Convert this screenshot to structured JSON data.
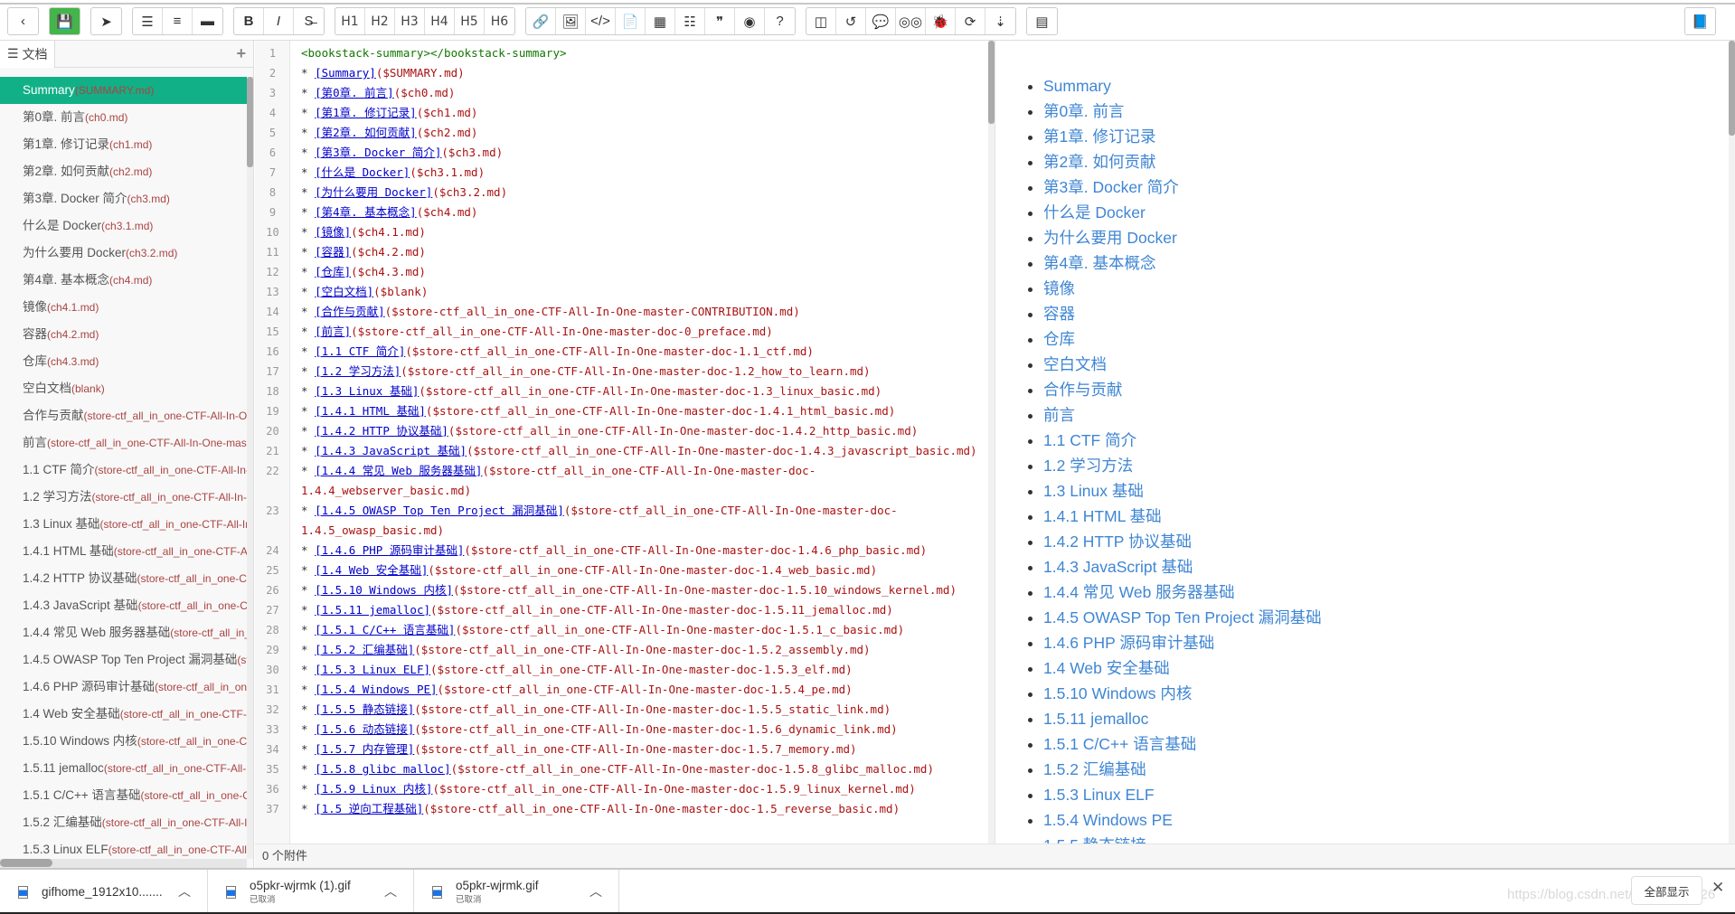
{
  "toolbar": {
    "groups": [
      [
        {
          "name": "back-button",
          "icon": "‹"
        }
      ],
      [
        {
          "name": "save-button",
          "icon": "💾",
          "save": true
        }
      ],
      [
        {
          "name": "publish-button",
          "icon": "➤"
        }
      ],
      [
        {
          "name": "unordered-list-button",
          "icon": "☰"
        },
        {
          "name": "ordered-list-button",
          "icon": "≡"
        },
        {
          "name": "horizontal-rule-button",
          "icon": "▬"
        }
      ],
      [
        {
          "name": "bold-button",
          "icon": "B"
        },
        {
          "name": "italic-button",
          "icon": "I"
        },
        {
          "name": "strikethrough-button",
          "icon": "S̶"
        }
      ],
      [
        {
          "name": "h1-button",
          "label": "H1"
        },
        {
          "name": "h2-button",
          "label": "H2"
        },
        {
          "name": "h3-button",
          "label": "H3"
        },
        {
          "name": "h4-button",
          "label": "H4"
        },
        {
          "name": "h5-button",
          "label": "H5"
        },
        {
          "name": "h6-button",
          "label": "H6"
        }
      ],
      [
        {
          "name": "link-button",
          "icon": "🔗"
        },
        {
          "name": "image-button",
          "icon": "🖼"
        },
        {
          "name": "code-button",
          "icon": "</>"
        },
        {
          "name": "code-block-button",
          "icon": "📄"
        },
        {
          "name": "table-button",
          "icon": "▦"
        },
        {
          "name": "toc-button",
          "icon": "☷"
        },
        {
          "name": "quote-button",
          "icon": "❞"
        },
        {
          "name": "dashboard-button",
          "icon": "◉"
        },
        {
          "name": "help-button",
          "icon": "?"
        }
      ],
      [
        {
          "name": "split-view-button",
          "icon": "◫"
        },
        {
          "name": "undo-button",
          "icon": "↺"
        },
        {
          "name": "comment-button",
          "icon": "💬"
        },
        {
          "name": "preview-button",
          "icon": "◎◎"
        },
        {
          "name": "debug-button",
          "icon": "🐞"
        },
        {
          "name": "refresh-button",
          "icon": "⟳"
        },
        {
          "name": "sort-button",
          "icon": "⇣"
        }
      ],
      [
        {
          "name": "document-button",
          "icon": "▤"
        }
      ]
    ],
    "right_icon": "📘"
  },
  "sidebar": {
    "tab_label": "文档",
    "add_icon": "+",
    "active_index": 0
  },
  "docs": [
    {
      "title": "Summary",
      "file": "SUMMARY.md"
    },
    {
      "title": "第0章. 前言",
      "file": "ch0.md"
    },
    {
      "title": "第1章. 修订记录",
      "file": "ch1.md"
    },
    {
      "title": "第2章. 如何贡献",
      "file": "ch2.md"
    },
    {
      "title": "第3章. Docker 简介",
      "file": "ch3.md"
    },
    {
      "title": "什么是 Docker",
      "file": "ch3.1.md"
    },
    {
      "title": "为什么要用 Docker",
      "file": "ch3.2.md"
    },
    {
      "title": "第4章. 基本概念",
      "file": "ch4.md"
    },
    {
      "title": "镜像",
      "file": "ch4.1.md"
    },
    {
      "title": "容器",
      "file": "ch4.2.md"
    },
    {
      "title": "仓库",
      "file": "ch4.3.md"
    },
    {
      "title": "空白文档",
      "file": "blank"
    },
    {
      "title": "合作与贡献",
      "file": "store-ctf_all_in_one-CTF-All-In-One-master-CONTRIBUTION.md"
    },
    {
      "title": "前言",
      "file": "store-ctf_all_in_one-CTF-All-In-One-master-doc-0_preface.md"
    },
    {
      "title": "1.1 CTF 简介",
      "file": "store-ctf_all_in_one-CTF-All-In-One-master-doc-1.1_ctf.md"
    },
    {
      "title": "1.2 学习方法",
      "file": "store-ctf_all_in_one-CTF-All-In-One-master-doc-1.2_how_to_learn.md"
    },
    {
      "title": "1.3 Linux 基础",
      "file": "store-ctf_all_in_one-CTF-All-In-One-master-doc-1.3_linux_basic.md"
    },
    {
      "title": "1.4.1 HTML 基础",
      "file": "store-ctf_all_in_one-CTF-All-In-One-master-doc-1.4.1_html_basic.md"
    },
    {
      "title": "1.4.2 HTTP 协议基础",
      "file": "store-ctf_all_in_one-CTF-All-In-One-master-doc-1.4.2_http_basic.md"
    },
    {
      "title": "1.4.3 JavaScript 基础",
      "file": "store-ctf_all_in_one-CTF-All-In-One-master-doc-1.4.3_javascript_basic.md"
    },
    {
      "title": "1.4.4 常见 Web 服务器基础",
      "file": "store-ctf_all_in_one-CTF-All-In-One-master-doc-1.4.4_webserver_basic.md"
    },
    {
      "title": "1.4.5 OWASP Top Ten Project 漏洞基础",
      "file": "store-ctf_all_in_one-CTF-All-In-One-master-doc-1.4.5_owasp_basic.md"
    },
    {
      "title": "1.4.6 PHP 源码审计基础",
      "file": "store-ctf_all_in_one-CTF-All-In-One-master-doc-1.4.6_php_basic.md"
    },
    {
      "title": "1.4 Web 安全基础",
      "file": "store-ctf_all_in_one-CTF-All-In-One-master-doc-1.4_web_basic.md"
    },
    {
      "title": "1.5.10 Windows 内核",
      "file": "store-ctf_all_in_one-CTF-All-In-One-master-doc-1.5.10_windows_kernel.md"
    },
    {
      "title": "1.5.11 jemalloc",
      "file": "store-ctf_all_in_one-CTF-All-In-One-master-doc-1.5.11_jemalloc.md"
    },
    {
      "title": "1.5.1 C/C++ 语言基础",
      "file": "store-ctf_all_in_one-CTF-All-In-One-master-doc-1.5.1_c_basic.md"
    },
    {
      "title": "1.5.2 汇编基础",
      "file": "store-ctf_all_in_one-CTF-All-In-One-master-doc-1.5.2_assembly.md"
    },
    {
      "title": "1.5.3 Linux ELF",
      "file": "store-ctf_all_in_one-CTF-All-In-One-master-doc-1.5.3_elf.md"
    },
    {
      "title": "1.5.4 Windows PE",
      "file": "store-ctf_all_in_one-CTF-All-In-One-master-doc-1.5.4_pe.md"
    },
    {
      "title": "1.5.5 静态链接",
      "file": "store-ctf_all_in_one-CTF-All-In-One-master-doc-1.5.5_static_link.md"
    },
    {
      "title": "1.5.6 动态链接",
      "file": "store-ctf_all_in_one-CTF-All-In-One-master-doc-1.5.6_dynamic_link.md"
    },
    {
      "title": "1.5.7 内存管理",
      "file": "store-ctf_all_in_one-CTF-All-In-One-master-doc-1.5.7_memory.md"
    },
    {
      "title": "1.5.8 glibc malloc",
      "file": "store-ctf_all_in_one-CTF-All-In-One-master-doc-1.5.8_glibc_malloc.md"
    },
    {
      "title": "1.5.9 Linux 内核",
      "file": "store-ctf_all_in_one-CTF-All-In-One-master-doc-1.5.9_linux_kernel.md"
    },
    {
      "title": "1.5 逆向工程基础",
      "file": "store-ctf_all_in_one-CTF-All-In-One-master-doc-1.5_reverse_basic.md"
    }
  ],
  "editor": {
    "first_line": "<bookstack-summary></bookstack-summary>",
    "bullet": "* ",
    "path_prefix": "$"
  },
  "status": {
    "attachments": "0 个附件"
  },
  "downloads": {
    "items": [
      {
        "name": "gifhome_1912x10.......",
        "status": ""
      },
      {
        "name": "o5pkr-wjrmk (1).gif",
        "status": "已取消"
      },
      {
        "name": "o5pkr-wjrmk.gif",
        "status": "已取消"
      }
    ],
    "show_all": "全部显示",
    "close_icon": "✕",
    "watermark": "https://blog.csdn.net/qq_41861526"
  },
  "colors": {
    "accent": "#12b087",
    "save": "#44b549",
    "link": "#3f86d3",
    "file": "#a94442"
  }
}
